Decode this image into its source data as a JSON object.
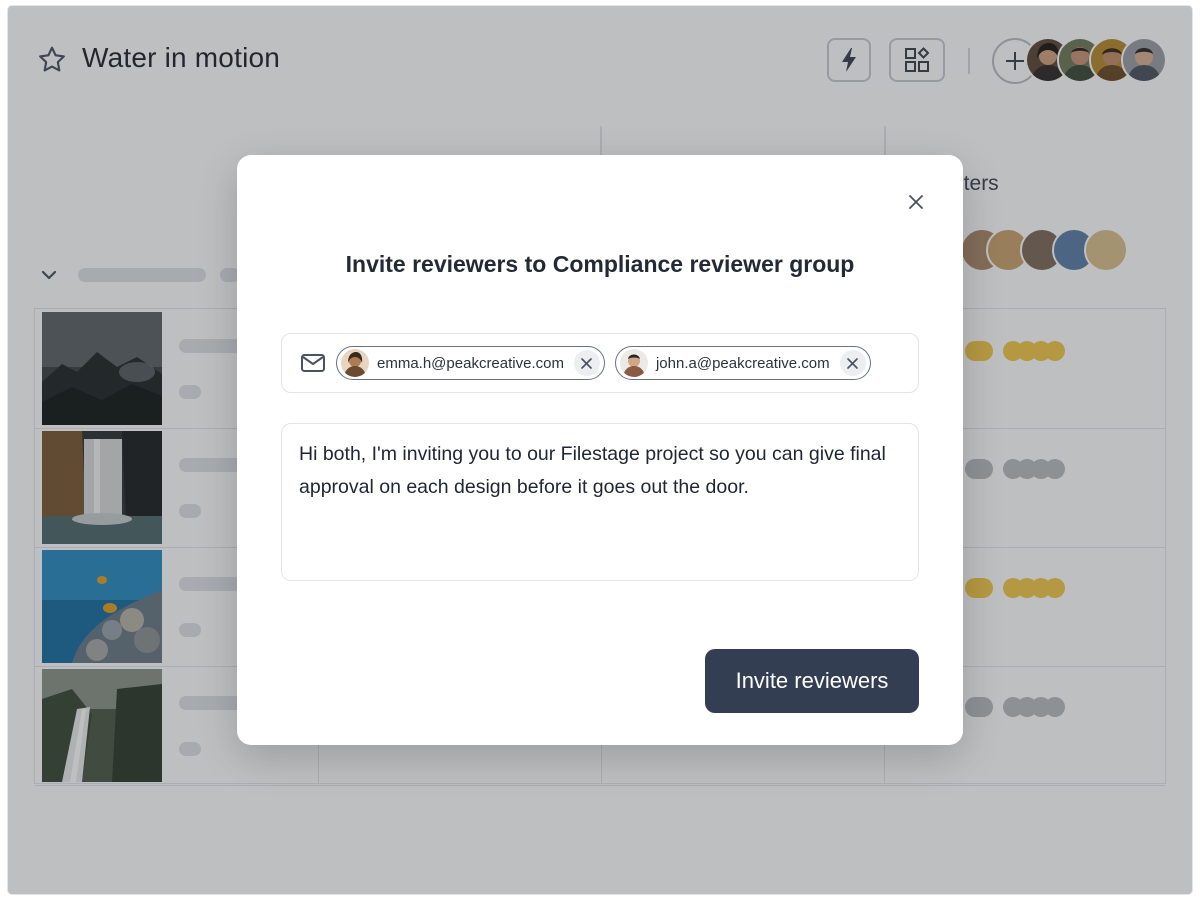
{
  "project": {
    "title": "Water in motion",
    "star_icon": "star-icon",
    "toolbar": {
      "automation_icon": "lightning-icon",
      "apps_icon": "apps-icon",
      "add_member_icon": "plus-icon"
    }
  },
  "board": {
    "column_heading_partial": "nters"
  },
  "modal": {
    "title": "Invite reviewers to Compliance reviewer group",
    "close_icon": "close-icon",
    "recipients": [
      {
        "email": "emma.h@peakcreative.com"
      },
      {
        "email": "john.a@peakcreative.com"
      }
    ],
    "message": "Hi both, I'm inviting you to our Filestage project so you can give final approval on each design before it goes out the door.",
    "submit_label": "Invite reviewers"
  },
  "colors": {
    "primary_button": "#333e52",
    "overlay": "rgba(40,42,48,0.30)",
    "status_yellow": "#f2c84b",
    "status_gray": "#b9bcc2"
  }
}
